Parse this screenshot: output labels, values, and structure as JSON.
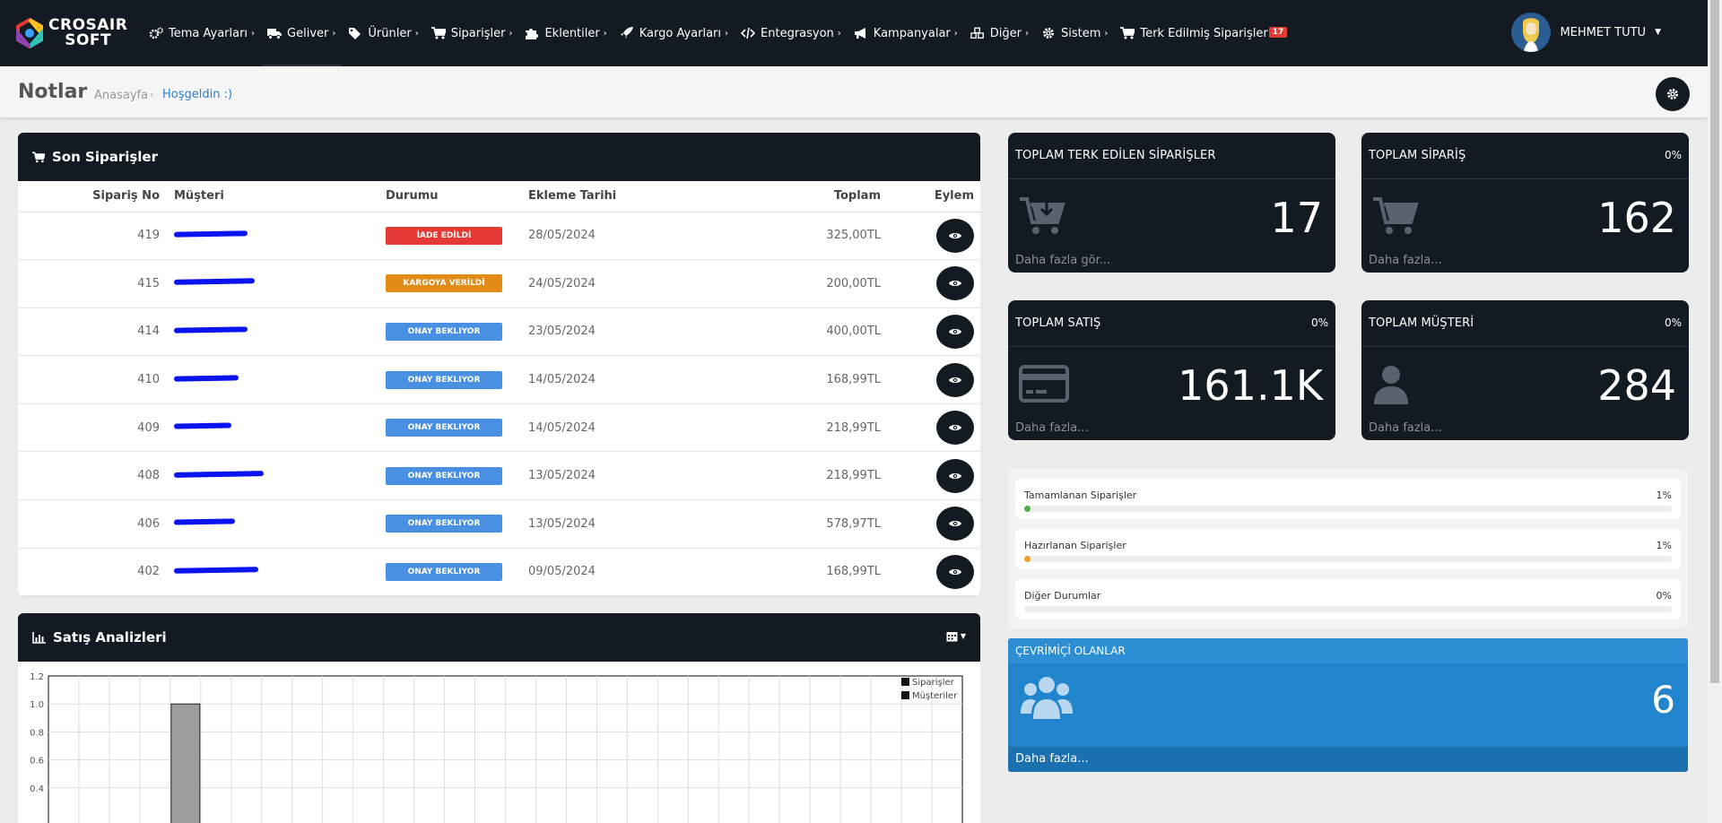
{
  "brand": {
    "line1": "CROSAIR",
    "line2": "SOFT"
  },
  "nav": [
    {
      "label": "Tema Ayarları",
      "icon": "cogs-icon"
    },
    {
      "label": "Geliver",
      "icon": "truck-icon"
    },
    {
      "label": "Ürünler",
      "icon": "tags-icon"
    },
    {
      "label": "Siparişler",
      "icon": "cart-icon"
    },
    {
      "label": "Eklentiler",
      "icon": "puzzle-icon"
    },
    {
      "label": "Kargo Ayarları",
      "icon": "rocket-icon"
    },
    {
      "label": "Entegrasyon",
      "icon": "code-icon"
    },
    {
      "label": "Kampanyalar",
      "icon": "bullhorn-icon"
    },
    {
      "label": "Diğer",
      "icon": "cubes-icon"
    },
    {
      "label": "Sistem",
      "icon": "gear-icon"
    },
    {
      "label": "Terk Edilmiş Siparişler",
      "icon": "cart-icon",
      "badge": "17"
    }
  ],
  "user": {
    "name": "MEHMET TUTU"
  },
  "breadcrumb": {
    "title": "Notlar",
    "home": "Anasayfa",
    "sep": "›",
    "current": "Hoşgeldin :)"
  },
  "orders": {
    "title": "Son Siparişler",
    "columns": [
      "Sipariş No",
      "Müşteri",
      "Durumu",
      "Ekleme Tarihi",
      "Toplam",
      "Eylem"
    ],
    "rows": [
      {
        "no": "419",
        "status": "İADE EDİLDİ",
        "status_color": "#e53935",
        "date": "28/05/2024",
        "total": "325,00TL"
      },
      {
        "no": "415",
        "status": "KARGOYA VERİLDİ",
        "status_color": "#e08c16",
        "date": "24/05/2024",
        "total": "200,00TL"
      },
      {
        "no": "414",
        "status": "ONAY BEKLIYOR",
        "status_color": "#4a90e2",
        "date": "23/05/2024",
        "total": "400,00TL"
      },
      {
        "no": "410",
        "status": "ONAY BEKLIYOR",
        "status_color": "#4a90e2",
        "date": "14/05/2024",
        "total": "168,99TL"
      },
      {
        "no": "409",
        "status": "ONAY BEKLIYOR",
        "status_color": "#4a90e2",
        "date": "14/05/2024",
        "total": "218,99TL"
      },
      {
        "no": "408",
        "status": "ONAY BEKLIYOR",
        "status_color": "#4a90e2",
        "date": "13/05/2024",
        "total": "218,99TL"
      },
      {
        "no": "406",
        "status": "ONAY BEKLIYOR",
        "status_color": "#4a90e2",
        "date": "13/05/2024",
        "total": "578,97TL"
      },
      {
        "no": "402",
        "status": "ONAY BEKLIYOR",
        "status_color": "#4a90e2",
        "date": "09/05/2024",
        "total": "168,99TL"
      }
    ]
  },
  "analytics": {
    "title": "Satış Analizleri"
  },
  "chart_data": {
    "type": "bar",
    "yticks": [
      "1.2",
      "1.0",
      "0.8",
      "0.6",
      "0.4"
    ],
    "ylim": [
      0,
      1.2
    ],
    "grid": true,
    "legend_position": "top-right",
    "series": [
      {
        "name": "Siparişler",
        "color": "#9e9e9e",
        "values": [
          0,
          0,
          0,
          0,
          1.0,
          0,
          0,
          0,
          0,
          0,
          0,
          0,
          0,
          0,
          0,
          0,
          0,
          0,
          0,
          0,
          0,
          0,
          0,
          0,
          0,
          0,
          0,
          0,
          0,
          0
        ]
      },
      {
        "name": "Müşteriler",
        "color": "#111111",
        "values": []
      }
    ]
  },
  "stats": [
    {
      "title": "TOPLAM TERK EDİLEN SİPARİŞLER",
      "pct": "",
      "value": "17",
      "link": "Daha fazla gör...",
      "icon": "cart-download-icon"
    },
    {
      "title": "TOPLAM SİPARİŞ",
      "pct": "0%",
      "value": "162",
      "link": "Daha fazla...",
      "icon": "cart-icon"
    },
    {
      "title": "TOPLAM SATIŞ",
      "pct": "0%",
      "value": "161.1K",
      "link": "Daha fazla...",
      "icon": "credit-card-icon"
    },
    {
      "title": "TOPLAM MÜŞTERİ",
      "pct": "0%",
      "value": "284",
      "link": "Daha fazla...",
      "icon": "user-icon"
    }
  ],
  "progress": [
    {
      "label": "Tamamlanan Siparişler",
      "pct": "1%",
      "value": 0.01,
      "color": "#4caf50"
    },
    {
      "label": "Hazırlanan Siparişler",
      "pct": "1%",
      "value": 0.01,
      "color": "#f0a030"
    },
    {
      "label": "Diğer Durumlar",
      "pct": "0%",
      "value": 0,
      "color": "#4a90e2"
    }
  ],
  "online": {
    "title": "ÇEVRİMİÇİ OLANLAR",
    "value": "6",
    "link": "Daha fazla..."
  }
}
